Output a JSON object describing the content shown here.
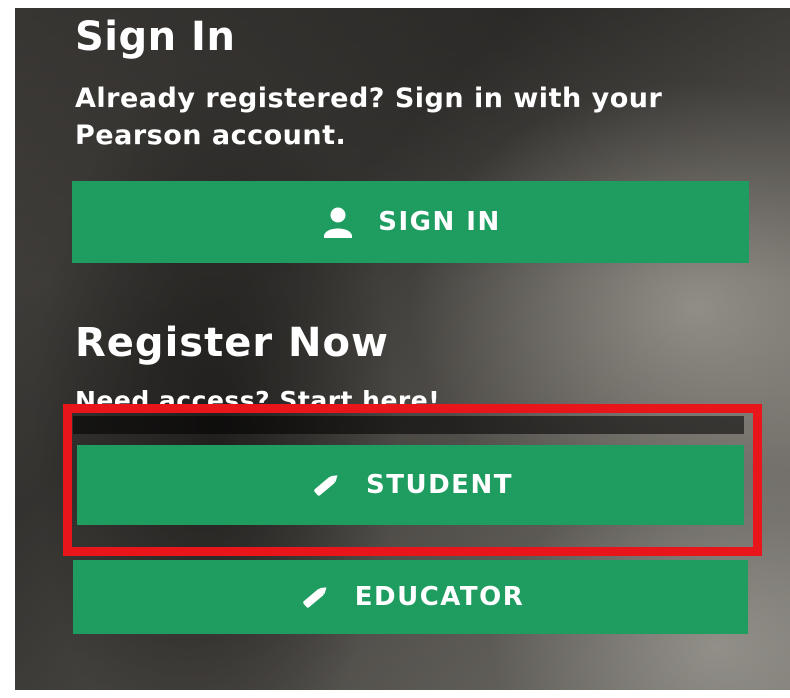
{
  "signin": {
    "title": "Sign In",
    "description": "Already registered? Sign in with your Pearson account.",
    "button_label": "SIGN IN",
    "button_icon": "user-icon"
  },
  "register": {
    "title": "Register Now",
    "description": "Need access? Start here!",
    "student_label": "STUDENT",
    "educator_label": "EDUCATOR",
    "button_icon": "pencil-icon"
  },
  "colors": {
    "button_green": "#1f9d61",
    "highlight_red": "#e8161b",
    "text": "#ffffff"
  }
}
